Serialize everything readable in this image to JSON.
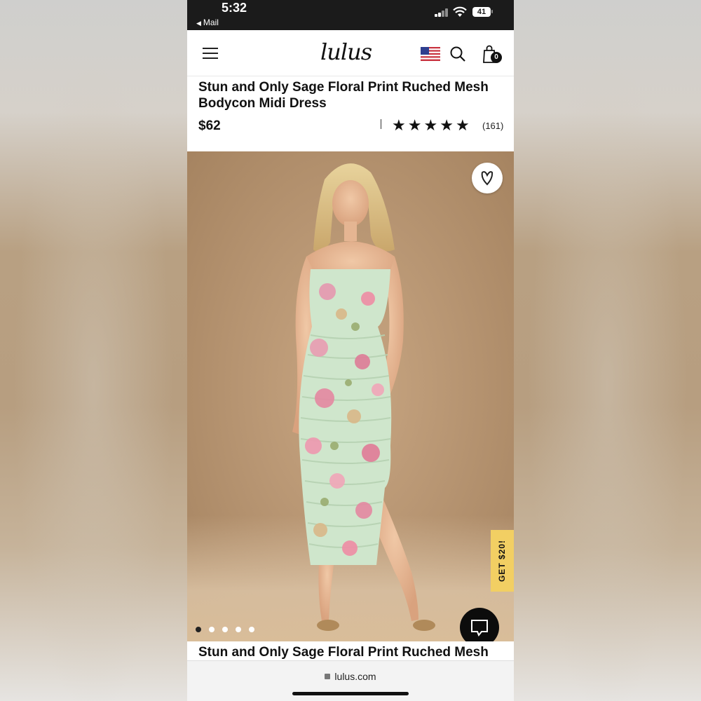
{
  "status_bar": {
    "time": "5:32",
    "back_label": "Mail",
    "battery": "41"
  },
  "header": {
    "logo": "lulus",
    "bag_count": "0"
  },
  "product": {
    "title": "Stun and Only Sage Floral Print Ruched Mesh Bodycon Midi Dress",
    "title_repeat": "Stun and Only Sage Floral Print Ruched Mesh",
    "price": "$62",
    "rating": 4.8,
    "review_count": "(161)"
  },
  "hero": {
    "promo_label": "GET $20!",
    "carousel_total": 5,
    "carousel_active": 1
  },
  "browser": {
    "url": "lulus.com"
  },
  "colors": {
    "promo": "#f2cf63",
    "chat": "#0c0c0c",
    "status_bar": "#1b1b1b"
  },
  "icons": [
    "hamburger-icon",
    "us-flag-icon",
    "search-icon",
    "shopping-bag-icon",
    "heart-icon",
    "chat-icon",
    "lock-icon"
  ]
}
